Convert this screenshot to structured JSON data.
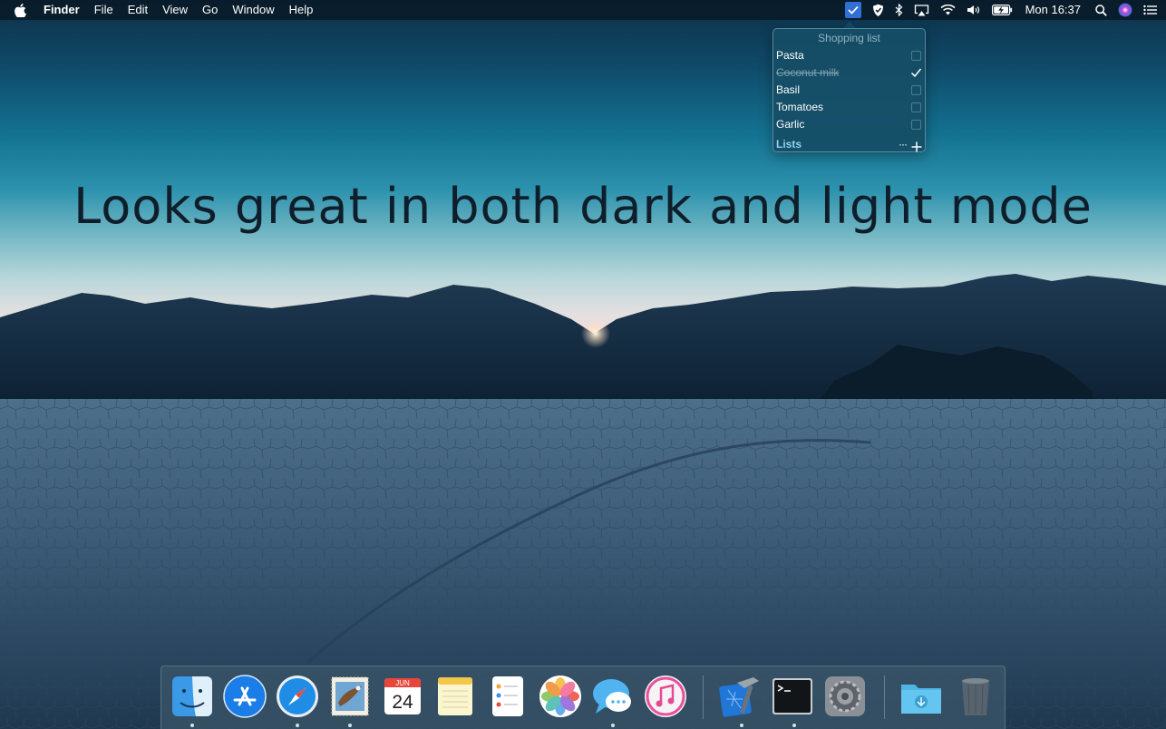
{
  "menubar": {
    "app_name": "Finder",
    "menus": [
      "File",
      "Edit",
      "View",
      "Go",
      "Window",
      "Help"
    ],
    "clock": "Mon 16:37",
    "status_icons": [
      "checklist-icon",
      "shield-icon",
      "bluetooth-icon",
      "airplay-icon",
      "wifi-icon",
      "volume-icon",
      "battery-charging-icon",
      "spotlight-search-icon",
      "siri-icon",
      "notification-center-icon"
    ]
  },
  "popover": {
    "title": "Shopping list",
    "items": [
      {
        "label": "Pasta",
        "done": false
      },
      {
        "label": "Coconut milk",
        "done": true
      },
      {
        "label": "Basil",
        "done": false
      },
      {
        "label": "Tomatoes",
        "done": false
      },
      {
        "label": "Garlic",
        "done": false
      }
    ],
    "footer_link": "Lists",
    "more_glyph": "···",
    "accent_color": "#8fd3ef"
  },
  "headline": "Looks great in both dark and light mode",
  "dock": {
    "apps": [
      {
        "name": "finder-icon",
        "running": true
      },
      {
        "name": "app-store-icon",
        "running": false
      },
      {
        "name": "safari-icon",
        "running": true
      },
      {
        "name": "mail-icon",
        "running": true
      },
      {
        "name": "calendar-icon",
        "running": false,
        "month": "JUN",
        "day": "24"
      },
      {
        "name": "notes-icon",
        "running": false
      },
      {
        "name": "reminders-icon",
        "running": false
      },
      {
        "name": "photos-icon",
        "running": false
      },
      {
        "name": "messages-icon",
        "running": true
      },
      {
        "name": "itunes-icon",
        "running": false
      },
      {
        "name": "xcode-icon",
        "running": true
      },
      {
        "name": "terminal-icon",
        "running": true
      },
      {
        "name": "system-preferences-icon",
        "running": false
      },
      {
        "name": "downloads-folder-icon",
        "running": false
      },
      {
        "name": "trash-icon",
        "running": false
      }
    ]
  }
}
